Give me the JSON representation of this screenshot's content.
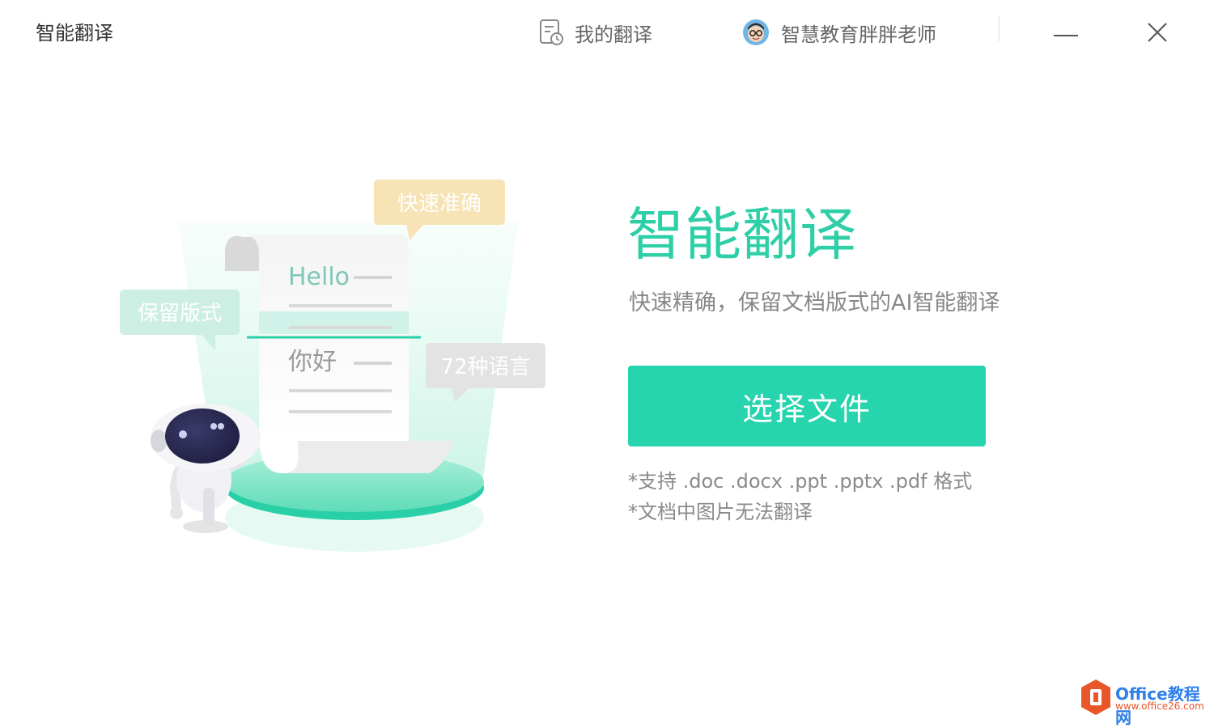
{
  "titlebar": {
    "app_title": "智能翻译",
    "my_translations": "我的翻译",
    "user_name": "智慧教育胖胖老师"
  },
  "illustration": {
    "bubble_fast": "快速准确",
    "bubble_format": "保留版式",
    "bubble_languages": "72种语言",
    "scroll_source": "Hello",
    "scroll_target": "你好"
  },
  "main": {
    "title": "智能翻译",
    "subtitle": "快速精确，保留文档版式的AI智能翻译",
    "select_button": "选择文件",
    "note_formats": "*支持 .doc .docx .ppt .pptx .pdf 格式",
    "note_images": "*文档中图片无法翻译"
  },
  "watermark": {
    "name": "Office教程网",
    "url": "www.office26.com"
  },
  "colors": {
    "accent": "#26d4ae",
    "accent_text": "#2ecfa7",
    "bubble_fast": "#f7e3b5",
    "bubble_format": "#cdeee3",
    "bubble_languages": "#e3e3e3"
  },
  "icons": [
    "document-history-icon",
    "avatar",
    "minimize-icon",
    "close-icon",
    "office-logo-icon"
  ]
}
